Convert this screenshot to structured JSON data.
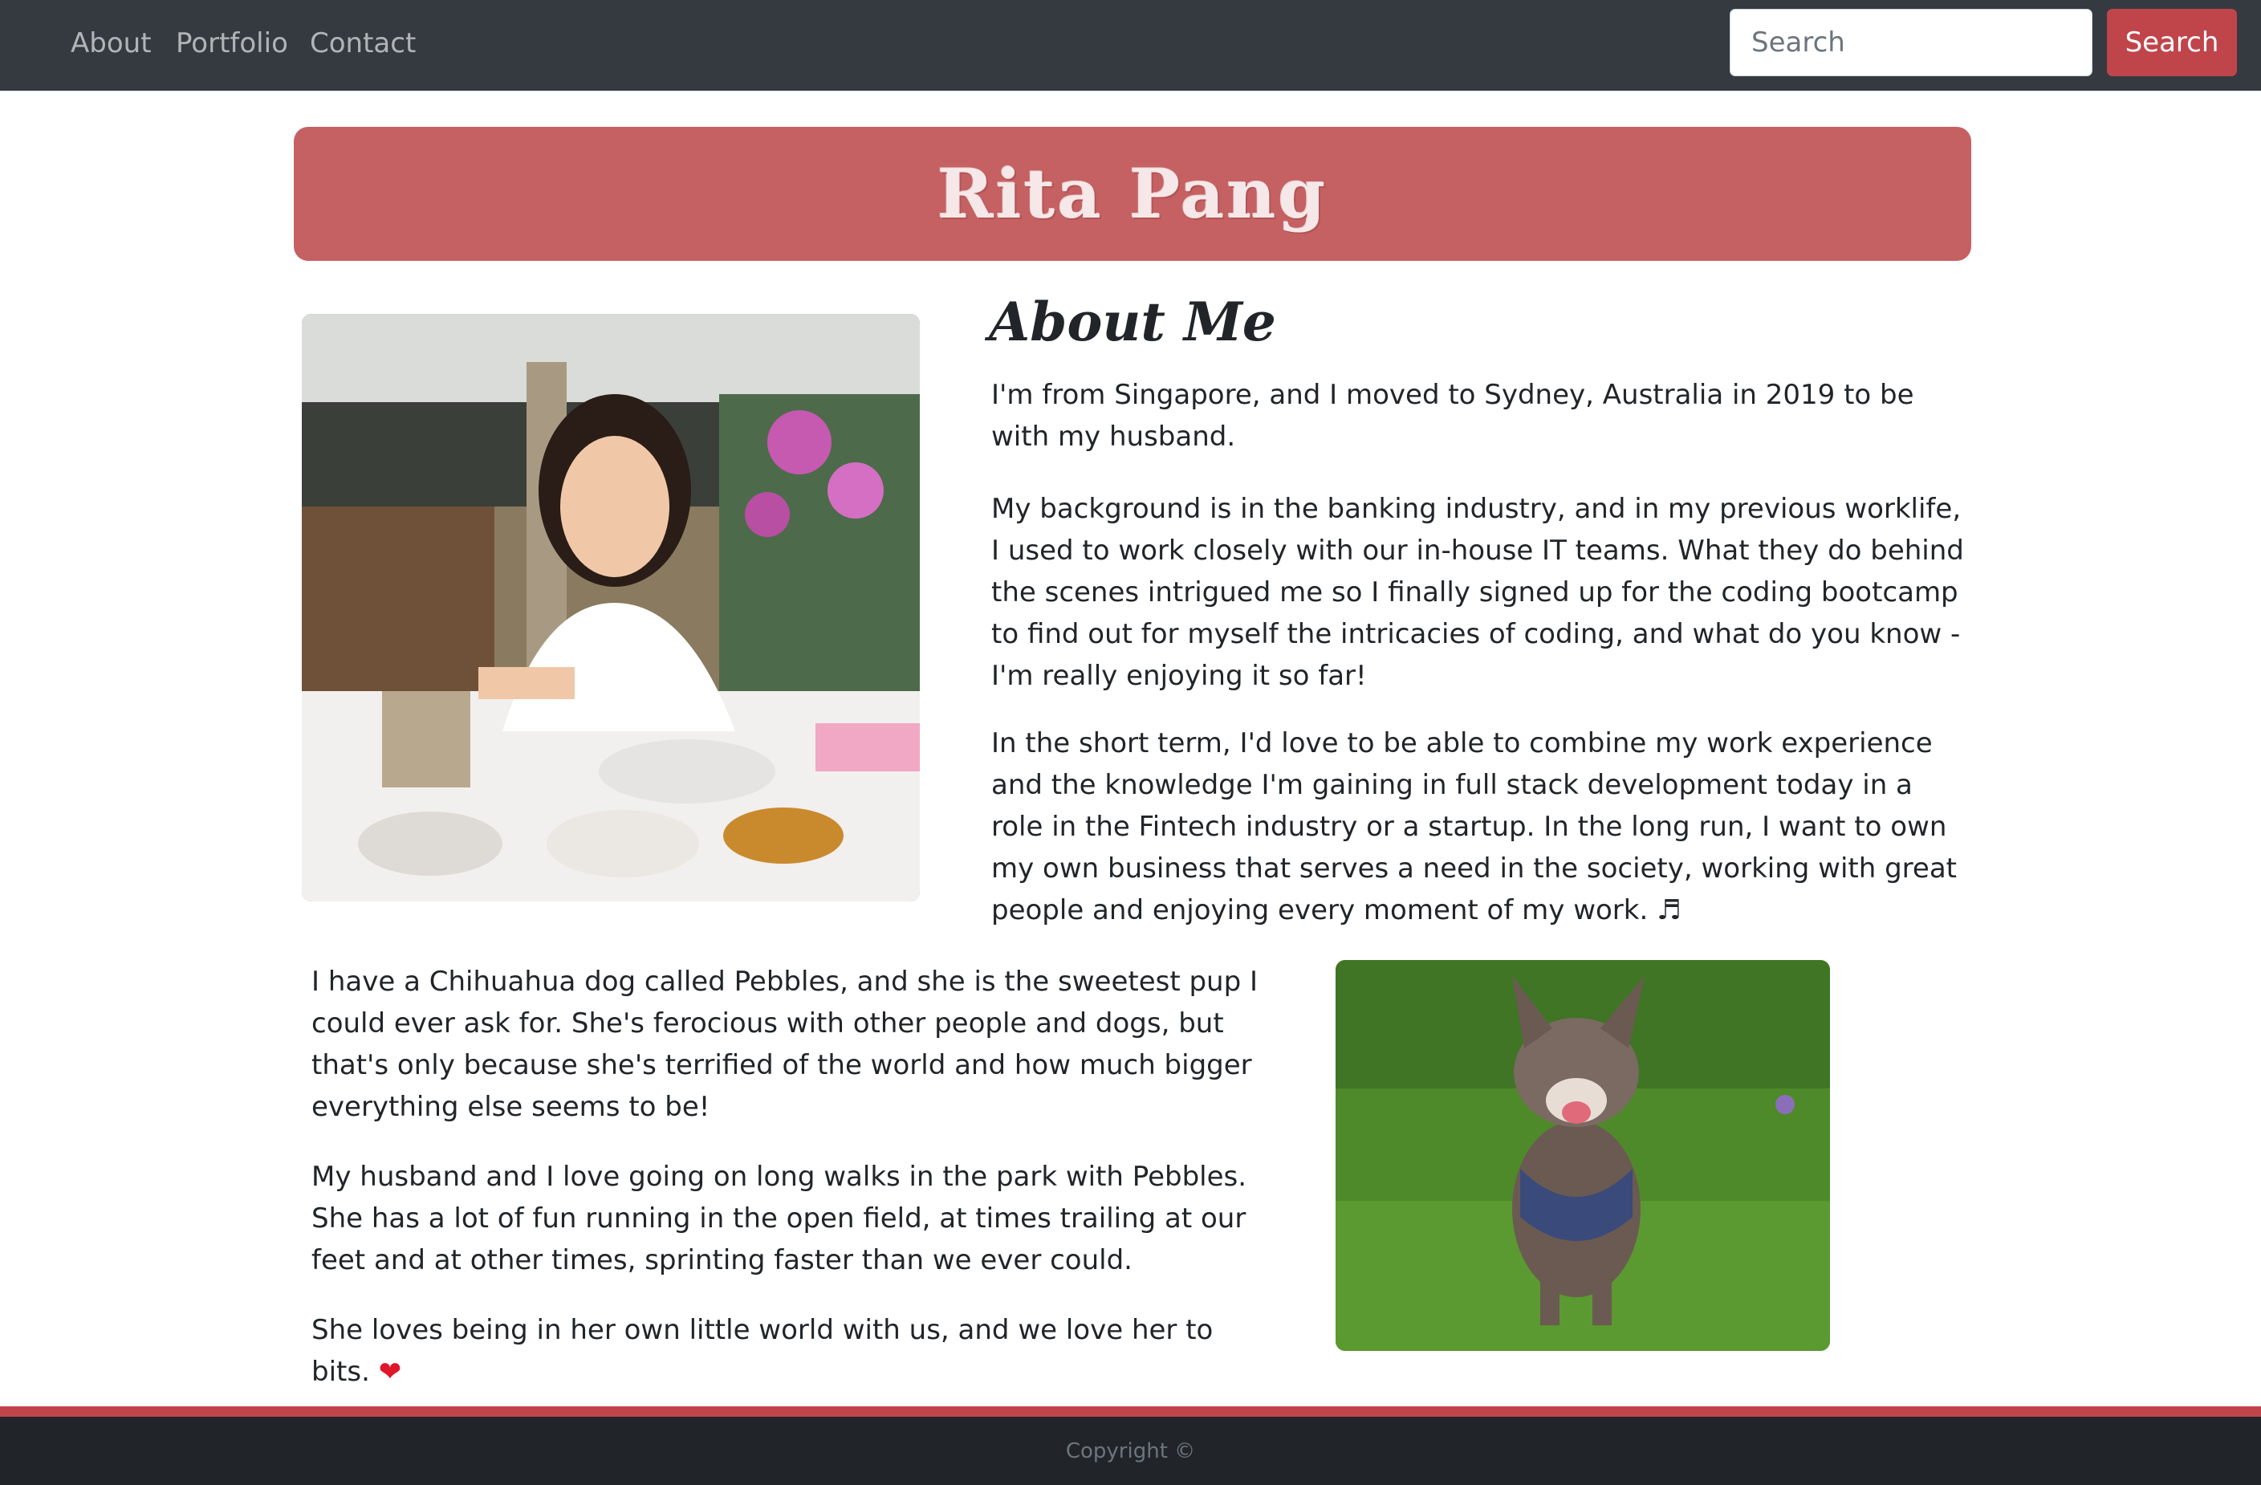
{
  "nav": {
    "links": [
      "About",
      "Portfolio",
      "Contact"
    ],
    "search_placeholder": "Search",
    "search_button": "Search"
  },
  "header": {
    "title": "Rita Pang"
  },
  "about": {
    "heading": "About Me",
    "paragraphs": [
      "I'm from Singapore, and I moved to Sydney, Australia in 2019 to be with my husband.",
      "My background is in the banking industry, and in my previous worklife, I used to work closely with our in-house IT teams. What they do behind the scenes intrigued me so I finally signed up for the coding bootcamp to find out for myself the intricacies of coding, and what do you know - I'm really enjoying it so far!",
      "In the short term, I'd love to be able to combine my work experience and the knowledge I'm gaining in full stack development today in a role in the Fintech industry or a startup. In the long run, I want to own my own business that serves a need in the society, working with great people and enjoying every moment of my work."
    ],
    "music_emoji": "♬"
  },
  "pets": {
    "paragraphs": [
      "I have a Chihuahua dog called Pebbles, and she is the sweetest pup I could ever ask for. She's ferocious with other people and dogs, but that's only because she's terrified of the world and how much bigger everything else seems to be!",
      "My husband and I love going on long walks in the park with Pebbles. She has a lot of fun running in the open field, at times trailing at our feet and at other times, sprinting faster than we ever could.",
      "She loves being in her own little world with us, and we love her to bits."
    ],
    "heart_emoji": "❤"
  },
  "footer": {
    "copyright": "Copyright ©"
  },
  "colors": {
    "navbar": "#343a40",
    "accent": "#c0454b",
    "banner": "#c56163",
    "footer": "#212529"
  }
}
